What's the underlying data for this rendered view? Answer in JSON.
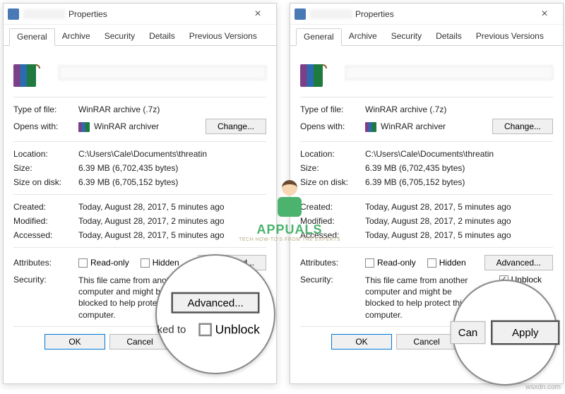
{
  "title": "Properties",
  "tabs": [
    "General",
    "Archive",
    "Security",
    "Details",
    "Previous Versions"
  ],
  "labels": {
    "type": "Type of file:",
    "opens": "Opens with:",
    "location": "Location:",
    "size": "Size:",
    "disk": "Size on disk:",
    "created": "Created:",
    "modified": "Modified:",
    "accessed": "Accessed:",
    "attributes": "Attributes:",
    "security": "Security:"
  },
  "values": {
    "type": "WinRAR archive (.7z)",
    "opens": "WinRAR archiver",
    "location": "C:\\Users\\Cale\\Documents\\threatin",
    "size": "6.39 MB (6,702,435 bytes)",
    "disk": "6.39 MB (6,705,152 bytes)",
    "created": "Today, August 28, 2017, 5 minutes ago",
    "modified": "Today, August 28, 2017, 2 minutes ago",
    "accessed": "Today, August 28, 2017, 5 minutes ago",
    "security_left": "This file came from another computer and might be blocked to help protect this computer.",
    "security_right": "This file came from another computer and might be blocked to help protect this computer."
  },
  "opts": {
    "readonly": "Read-only",
    "hidden": "Hidden",
    "unblock": "Unblock"
  },
  "buttons": {
    "change": "Change...",
    "advanced": "Advanced...",
    "ok": "OK",
    "cancel": "Cancel",
    "apply": "Apply"
  },
  "magnify": {
    "advanced": "Advanced...",
    "unblock": "Unblock",
    "partial": "ked to"
  },
  "brand": {
    "name": "APPUALS",
    "sub": "TECH HOW-TO'S FROM THE EXPERTS"
  },
  "watermark": "wsxdn.com"
}
